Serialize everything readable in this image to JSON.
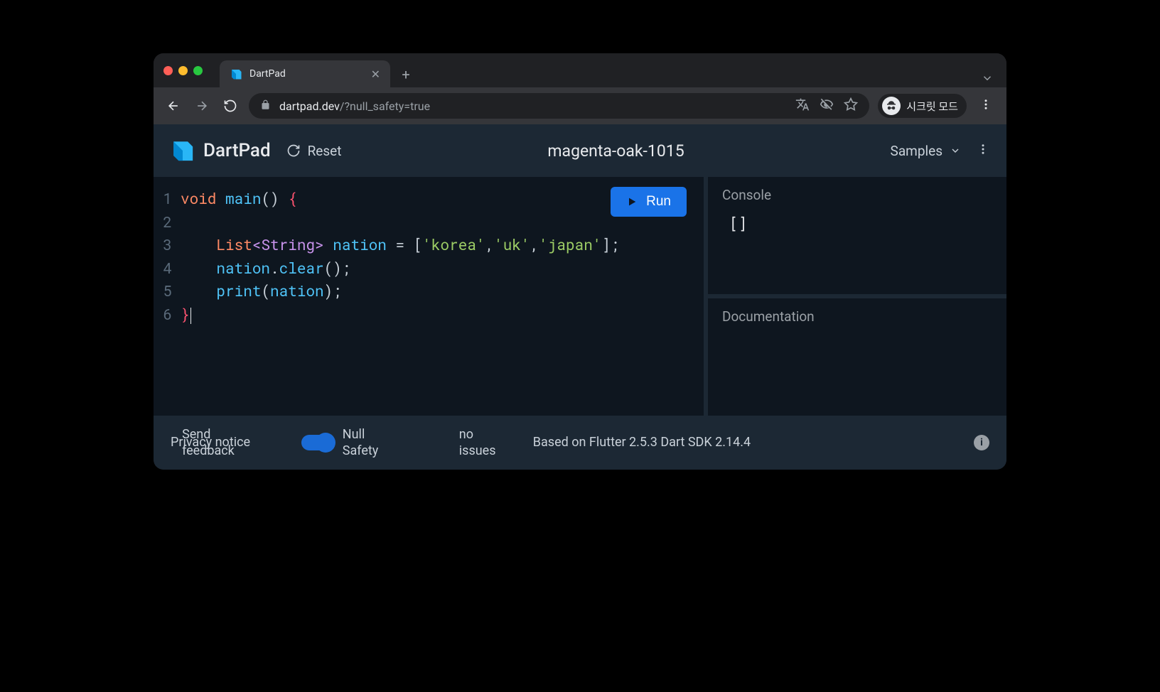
{
  "browser": {
    "tab_title": "DartPad",
    "url_host": "dartpad.dev",
    "url_path": "/?null_safety=true",
    "incognito_label": "시크릿 모드"
  },
  "app": {
    "name": "DartPad",
    "reset_label": "Reset",
    "project_name": "magenta-oak-1015",
    "samples_label": "Samples",
    "run_label": "Run"
  },
  "code": {
    "lines": [
      "1",
      "2",
      "3",
      "4",
      "5",
      "6"
    ],
    "raw": "void main() {\n\n    List<String> nation = ['korea','uk','japan'];\n    nation.clear();\n    print(nation);\n}",
    "l1_void": "void",
    "l1_main": "main",
    "l1_rest": "() ",
    "l1_brace": "{",
    "l3_indent": "    ",
    "l3_list": "List",
    "l3_gen": "<String>",
    "l3_sp": " ",
    "l3_nation": "nation",
    "l3_eq": " = [",
    "l3_s1": "'korea'",
    "l3_c": ",",
    "l3_s2": "'uk'",
    "l3_s3": "'japan'",
    "l3_end": "];",
    "l4_indent": "    ",
    "l4_nation": "nation",
    "l4_dot": ".",
    "l4_clear": "clear",
    "l4_end": "();",
    "l5_indent": "    ",
    "l5_print": "print",
    "l5_op": "(",
    "l5_nation": "nation",
    "l5_end": ");",
    "l6_brace": "}"
  },
  "console": {
    "title": "Console",
    "output": "[]"
  },
  "docs": {
    "title": "Documentation"
  },
  "footer": {
    "privacy": "Privacy notice",
    "send_feedback_a": "Send",
    "send_feedback_b": "feedback",
    "null_safety": "Null Safety",
    "issues": "no issues",
    "version": "Based on Flutter 2.5.3 Dart SDK 2.14.4"
  }
}
